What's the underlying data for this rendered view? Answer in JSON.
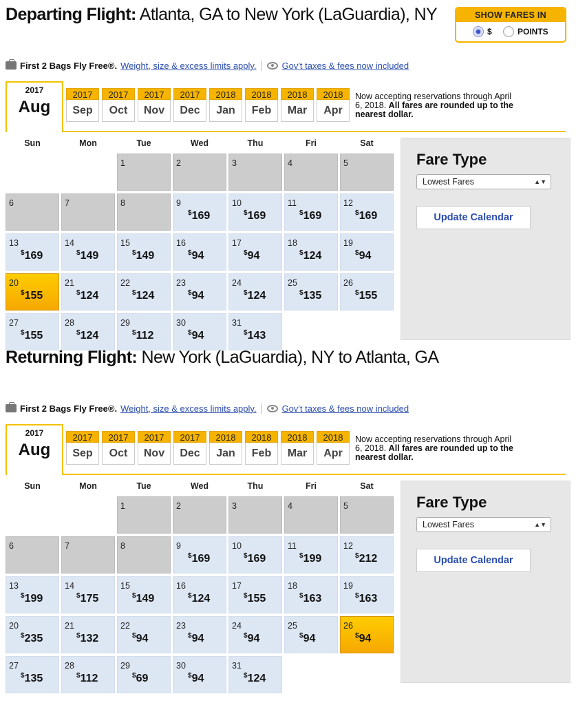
{
  "show_fares": {
    "title": "SHOW FARES IN",
    "options": [
      {
        "label": "$",
        "selected": true
      },
      {
        "label": "POINTS",
        "selected": false
      }
    ]
  },
  "depart": {
    "heading_bold": "Departing Flight:",
    "heading_rest": " Atlanta, GA to New York (LaGuardia), NY",
    "bags_strong": "First 2 Bags Fly Free®.",
    "bags_link": "Weight, size & excess limits apply.",
    "taxes_link": "Gov't taxes & fees now included",
    "current_year": "2017",
    "current_month": "Aug",
    "months": [
      {
        "year": "2017",
        "name": "Sep"
      },
      {
        "year": "2017",
        "name": "Oct"
      },
      {
        "year": "2017",
        "name": "Nov"
      },
      {
        "year": "2017",
        "name": "Dec"
      },
      {
        "year": "2018",
        "name": "Jan"
      },
      {
        "year": "2018",
        "name": "Feb"
      },
      {
        "year": "2018",
        "name": "Mar"
      },
      {
        "year": "2018",
        "name": "Apr"
      }
    ],
    "notice_plain": "Now accepting reservations through April 6, 2018.",
    "notice_bold": "All fares are rounded up to the nearest dollar.",
    "weekdays": [
      "Sun",
      "Mon",
      "Tue",
      "Wed",
      "Thu",
      "Fri",
      "Sat"
    ],
    "fare_type_title": "Fare Type",
    "fare_type_value": "Lowest Fares",
    "update_button": "Update Calendar",
    "days": [
      {
        "day": "1",
        "fare": "",
        "state": "gray"
      },
      {
        "day": "2",
        "fare": "",
        "state": "gray"
      },
      {
        "day": "3",
        "fare": "",
        "state": "gray"
      },
      {
        "day": "4",
        "fare": "",
        "state": "gray"
      },
      {
        "day": "5",
        "fare": "",
        "state": "gray"
      },
      {
        "day": "6",
        "fare": "",
        "state": "gray"
      },
      {
        "day": "7",
        "fare": "",
        "state": "gray"
      },
      {
        "day": "8",
        "fare": "",
        "state": "gray"
      },
      {
        "day": "9",
        "fare": "169",
        "state": "avail"
      },
      {
        "day": "10",
        "fare": "169",
        "state": "avail"
      },
      {
        "day": "11",
        "fare": "169",
        "state": "avail"
      },
      {
        "day": "12",
        "fare": "169",
        "state": "avail"
      },
      {
        "day": "13",
        "fare": "169",
        "state": "avail"
      },
      {
        "day": "14",
        "fare": "149",
        "state": "avail"
      },
      {
        "day": "15",
        "fare": "149",
        "state": "avail"
      },
      {
        "day": "16",
        "fare": "94",
        "state": "avail"
      },
      {
        "day": "17",
        "fare": "94",
        "state": "avail"
      },
      {
        "day": "18",
        "fare": "124",
        "state": "avail"
      },
      {
        "day": "19",
        "fare": "94",
        "state": "avail"
      },
      {
        "day": "20",
        "fare": "155",
        "state": "selected"
      },
      {
        "day": "21",
        "fare": "124",
        "state": "avail"
      },
      {
        "day": "22",
        "fare": "124",
        "state": "avail"
      },
      {
        "day": "23",
        "fare": "94",
        "state": "avail"
      },
      {
        "day": "24",
        "fare": "124",
        "state": "avail"
      },
      {
        "day": "25",
        "fare": "135",
        "state": "avail"
      },
      {
        "day": "26",
        "fare": "155",
        "state": "avail"
      },
      {
        "day": "27",
        "fare": "155",
        "state": "avail"
      },
      {
        "day": "28",
        "fare": "124",
        "state": "avail"
      },
      {
        "day": "29",
        "fare": "112",
        "state": "avail"
      },
      {
        "day": "30",
        "fare": "94",
        "state": "avail"
      },
      {
        "day": "31",
        "fare": "143",
        "state": "avail"
      }
    ]
  },
  "return": {
    "heading_bold": "Returning Flight:",
    "heading_rest": " New York (LaGuardia), NY to Atlanta, GA",
    "bags_strong": "First 2 Bags Fly Free®.",
    "bags_link": "Weight, size & excess limits apply.",
    "taxes_link": "Gov't taxes & fees now included",
    "current_year": "2017",
    "current_month": "Aug",
    "months": [
      {
        "year": "2017",
        "name": "Sep"
      },
      {
        "year": "2017",
        "name": "Oct"
      },
      {
        "year": "2017",
        "name": "Nov"
      },
      {
        "year": "2017",
        "name": "Dec"
      },
      {
        "year": "2018",
        "name": "Jan"
      },
      {
        "year": "2018",
        "name": "Feb"
      },
      {
        "year": "2018",
        "name": "Mar"
      },
      {
        "year": "2018",
        "name": "Apr"
      }
    ],
    "notice_plain": "Now accepting reservations through April 6, 2018.",
    "notice_bold": "All fares are rounded up to the nearest dollar.",
    "weekdays": [
      "Sun",
      "Mon",
      "Tue",
      "Wed",
      "Thu",
      "Fri",
      "Sat"
    ],
    "fare_type_title": "Fare Type",
    "fare_type_value": "Lowest Fares",
    "update_button": "Update Calendar",
    "days": [
      {
        "day": "1",
        "fare": "",
        "state": "gray"
      },
      {
        "day": "2",
        "fare": "",
        "state": "gray"
      },
      {
        "day": "3",
        "fare": "",
        "state": "gray"
      },
      {
        "day": "4",
        "fare": "",
        "state": "gray"
      },
      {
        "day": "5",
        "fare": "",
        "state": "gray"
      },
      {
        "day": "6",
        "fare": "",
        "state": "gray"
      },
      {
        "day": "7",
        "fare": "",
        "state": "gray"
      },
      {
        "day": "8",
        "fare": "",
        "state": "gray"
      },
      {
        "day": "9",
        "fare": "169",
        "state": "avail"
      },
      {
        "day": "10",
        "fare": "169",
        "state": "avail"
      },
      {
        "day": "11",
        "fare": "199",
        "state": "avail"
      },
      {
        "day": "12",
        "fare": "212",
        "state": "avail"
      },
      {
        "day": "13",
        "fare": "199",
        "state": "avail"
      },
      {
        "day": "14",
        "fare": "175",
        "state": "avail"
      },
      {
        "day": "15",
        "fare": "149",
        "state": "avail"
      },
      {
        "day": "16",
        "fare": "124",
        "state": "avail"
      },
      {
        "day": "17",
        "fare": "155",
        "state": "avail"
      },
      {
        "day": "18",
        "fare": "163",
        "state": "avail"
      },
      {
        "day": "19",
        "fare": "163",
        "state": "avail"
      },
      {
        "day": "20",
        "fare": "235",
        "state": "avail"
      },
      {
        "day": "21",
        "fare": "132",
        "state": "avail"
      },
      {
        "day": "22",
        "fare": "94",
        "state": "avail"
      },
      {
        "day": "23",
        "fare": "94",
        "state": "avail"
      },
      {
        "day": "24",
        "fare": "94",
        "state": "avail"
      },
      {
        "day": "25",
        "fare": "94",
        "state": "avail"
      },
      {
        "day": "26",
        "fare": "94",
        "state": "selected"
      },
      {
        "day": "27",
        "fare": "135",
        "state": "avail"
      },
      {
        "day": "28",
        "fare": "112",
        "state": "avail"
      },
      {
        "day": "29",
        "fare": "69",
        "state": "avail"
      },
      {
        "day": "30",
        "fare": "94",
        "state": "avail"
      },
      {
        "day": "31",
        "fare": "124",
        "state": "avail"
      }
    ]
  }
}
